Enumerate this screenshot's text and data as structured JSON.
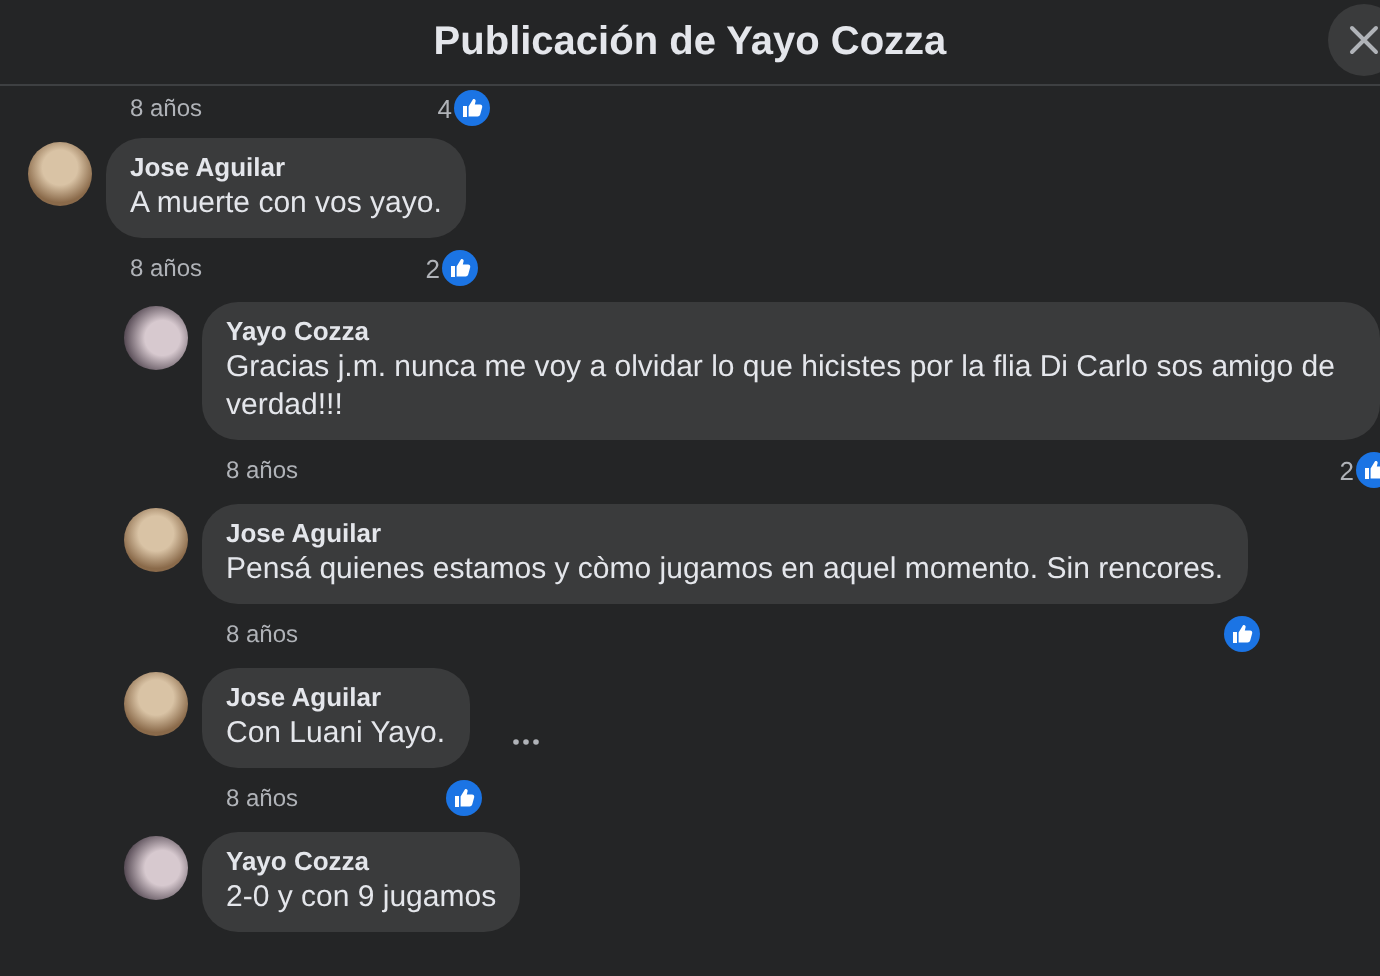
{
  "header": {
    "title": "Publicación de Yayo Cozza"
  },
  "previous_comment_footer": {
    "time": "8 años",
    "like_count": "4"
  },
  "comments": [
    {
      "author": "Jose Aguilar",
      "text": "A muerte con vos yayo.",
      "time": "8 años",
      "liked": true,
      "like_count": "2",
      "options_visible": false,
      "children": [
        {
          "author": "Yayo Cozza",
          "text": "Gracias j.m. nunca me voy a olvidar lo que hicistes por la flia Di Carlo sos amigo de verdad!!!",
          "time": "8 años",
          "liked": true,
          "like_count": "2",
          "options_visible": false
        },
        {
          "author": "Jose Aguilar",
          "text": "Pensá quienes estamos y còmo jugamos en aquel momento. Sin rencores.",
          "time": "8 años",
          "liked": true,
          "options_visible": false
        },
        {
          "author": "Jose Aguilar",
          "text": "Con Luani Yayo.",
          "time": "8 años",
          "liked": true,
          "options_visible": true
        },
        {
          "author": "Yayo Cozza",
          "text": "2-0 y con 9 jugamos",
          "liked": false,
          "options_visible": false
        }
      ]
    }
  ]
}
